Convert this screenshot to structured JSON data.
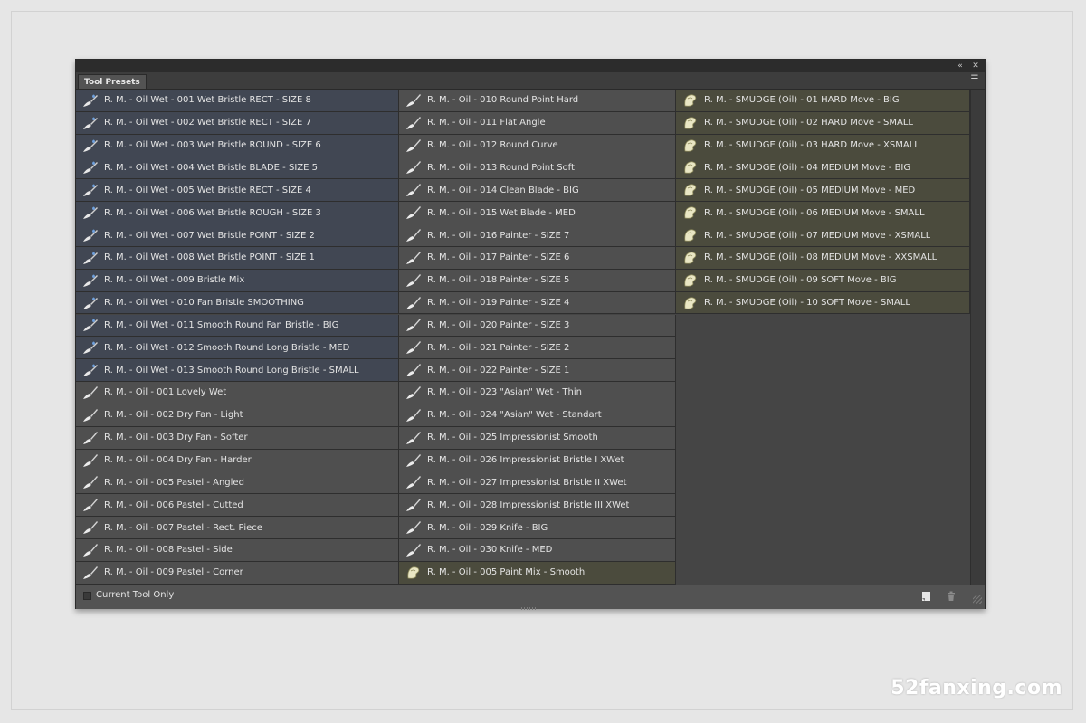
{
  "panel": {
    "tab_label": "Tool Presets",
    "collapse_icon": "double-chevron-left-icon",
    "close_icon": "close-icon",
    "menu_icon": "panel-menu-icon"
  },
  "presets": [
    {
      "label": "R. M. - Oil Wet - 001 Wet Bristle RECT - SIZE 8",
      "type": "wet"
    },
    {
      "label": "R. M. - Oil Wet - 002 Wet Bristle RECT - SIZE 7",
      "type": "wet"
    },
    {
      "label": "R. M. - Oil Wet - 003 Wet Bristle ROUND - SIZE 6",
      "type": "wet"
    },
    {
      "label": "R. M. - Oil Wet - 004 Wet Bristle BLADE - SIZE 5",
      "type": "wet"
    },
    {
      "label": "R. M. - Oil Wet - 005 Wet Bristle RECT - SIZE 4",
      "type": "wet"
    },
    {
      "label": "R. M. - Oil Wet - 006 Wet Bristle ROUGH - SIZE 3",
      "type": "wet"
    },
    {
      "label": "R. M. - Oil Wet - 007 Wet Bristle POINT - SIZE 2",
      "type": "wet"
    },
    {
      "label": "R. M. - Oil Wet - 008 Wet Bristle POINT - SIZE 1",
      "type": "wet"
    },
    {
      "label": "R. M. - Oil Wet - 009 Bristle Mix",
      "type": "wet"
    },
    {
      "label": "R. M. - Oil Wet - 010 Fan Bristle SMOOTHING",
      "type": "wet"
    },
    {
      "label": "R. M. - Oil Wet - 011 Smooth Round Fan Bristle - BIG",
      "type": "wet"
    },
    {
      "label": "R. M. - Oil Wet - 012 Smooth Round Long Bristle - MED",
      "type": "wet"
    },
    {
      "label": "R. M. - Oil Wet - 013 Smooth Round Long Bristle - SMALL",
      "type": "wet"
    },
    {
      "label": "R. M. - Oil - 001 Lovely Wet",
      "type": "oil"
    },
    {
      "label": "R. M. - Oil - 002 Dry Fan - Light",
      "type": "oil"
    },
    {
      "label": "R. M. - Oil - 003 Dry Fan - Softer",
      "type": "oil"
    },
    {
      "label": "R. M. - Oil - 004 Dry Fan - Harder",
      "type": "oil"
    },
    {
      "label": "R. M. - Oil - 005 Pastel - Angled",
      "type": "oil"
    },
    {
      "label": "R. M. - Oil - 006 Pastel - Cutted",
      "type": "oil"
    },
    {
      "label": "R. M. - Oil - 007 Pastel - Rect. Piece",
      "type": "oil"
    },
    {
      "label": "R. M. - Oil - 008 Pastel - Side",
      "type": "oil"
    },
    {
      "label": "R. M. - Oil - 009 Pastel - Corner",
      "type": "oil"
    },
    {
      "label": "R. M. - Oil - 010 Round Point Hard",
      "type": "oil"
    },
    {
      "label": "R. M. - Oil - 011 Flat Angle",
      "type": "oil"
    },
    {
      "label": "R. M. - Oil - 012 Round Curve",
      "type": "oil"
    },
    {
      "label": "R. M. - Oil - 013 Round Point Soft",
      "type": "oil"
    },
    {
      "label": "R. M. - Oil - 014 Clean Blade - BIG",
      "type": "oil"
    },
    {
      "label": "R. M. - Oil - 015 Wet Blade - MED",
      "type": "oil"
    },
    {
      "label": "R. M. - Oil - 016 Painter - SIZE 7",
      "type": "oil"
    },
    {
      "label": "R. M. - Oil - 017 Painter - SIZE 6",
      "type": "oil"
    },
    {
      "label": "R. M. - Oil - 018 Painter - SIZE 5",
      "type": "oil"
    },
    {
      "label": "R. M. - Oil - 019 Painter - SIZE 4",
      "type": "oil"
    },
    {
      "label": "R. M. - Oil - 020 Painter - SIZE 3",
      "type": "oil"
    },
    {
      "label": "R. M. - Oil - 021 Painter - SIZE 2",
      "type": "oil"
    },
    {
      "label": "R. M. - Oil - 022 Painter - SIZE 1",
      "type": "oil"
    },
    {
      "label": "R. M. - Oil - 023 \"Asian\" Wet - Thin",
      "type": "oil"
    },
    {
      "label": "R. M. - Oil - 024 \"Asian\" Wet - Standart",
      "type": "oil"
    },
    {
      "label": "R. M. - Oil - 025 Impressionist Smooth",
      "type": "oil"
    },
    {
      "label": "R. M. - Oil - 026 Impressionist Bristle I XWet",
      "type": "oil"
    },
    {
      "label": "R. M. - Oil - 027 Impressionist Bristle II XWet",
      "type": "oil"
    },
    {
      "label": "R. M. - Oil - 028 Impressionist Bristle III XWet",
      "type": "oil"
    },
    {
      "label": "R. M. - Oil - 029 Knife - BIG",
      "type": "oil"
    },
    {
      "label": "R. M. - Oil - 030 Knife - MED",
      "type": "oil"
    },
    {
      "label": "R. M. - Oil - 005 Paint Mix - Smooth",
      "type": "smudge"
    },
    {
      "label": "R. M. - SMUDGE (Oil) - 01 HARD Move - BIG",
      "type": "smudge"
    },
    {
      "label": "R. M. - SMUDGE (Oil) - 02 HARD Move - SMALL",
      "type": "smudge"
    },
    {
      "label": "R. M. - SMUDGE (Oil) - 03 HARD Move - XSMALL",
      "type": "smudge"
    },
    {
      "label": "R. M. - SMUDGE (Oil) - 04 MEDIUM Move - BIG",
      "type": "smudge"
    },
    {
      "label": "R. M. - SMUDGE (Oil) - 05 MEDIUM Move - MED",
      "type": "smudge"
    },
    {
      "label": "R. M. - SMUDGE (Oil) - 06 MEDIUM Move - SMALL",
      "type": "smudge"
    },
    {
      "label": "R. M. - SMUDGE (Oil) - 07 MEDIUM Move - XSMALL",
      "type": "smudge"
    },
    {
      "label": "R. M. - SMUDGE (Oil) - 08 MEDIUM Move - XXSMALL",
      "type": "smudge"
    },
    {
      "label": "R. M. - SMUDGE (Oil) - 09 SOFT Move - BIG",
      "type": "smudge"
    },
    {
      "label": "R. M. - SMUDGE (Oil) - 10 SOFT Move - SMALL",
      "type": "smudge"
    }
  ],
  "icons": {
    "wet": "mixer-brush-icon",
    "oil": "brush-icon",
    "smudge": "smudge-finger-icon"
  },
  "footer": {
    "checkbox_label": "Current Tool Only",
    "checkbox_checked": false,
    "new_preset_icon": "new-preset-icon",
    "delete_icon": "trash-icon"
  },
  "watermark": "52fanxing.com"
}
